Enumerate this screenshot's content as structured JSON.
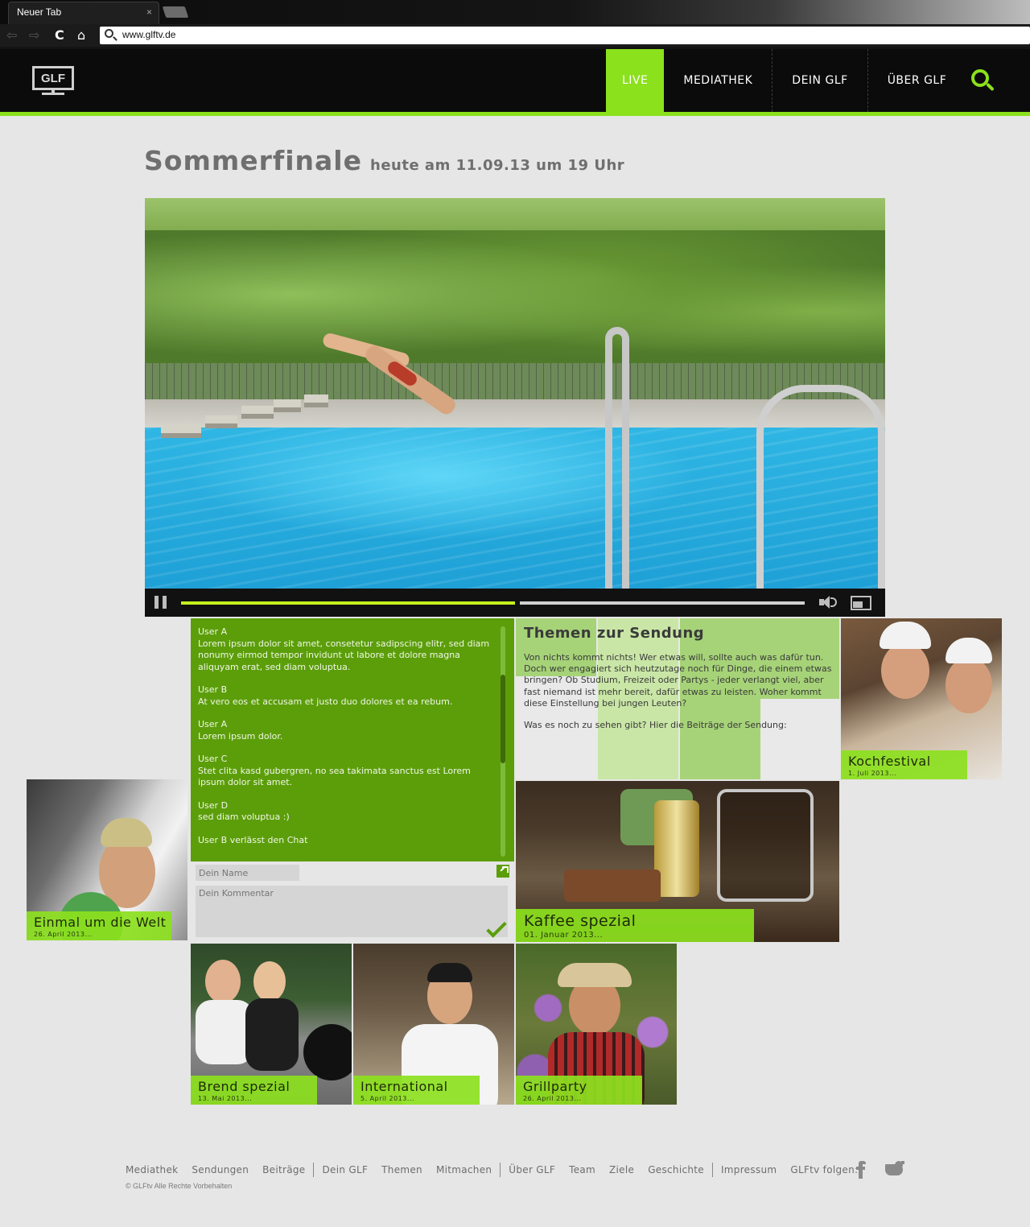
{
  "browser": {
    "tab_title": "Neuer Tab",
    "tab_close": "×",
    "url": "www.glftv.de",
    "back": "⇦",
    "forward": "⇨",
    "reload": "C",
    "home": "⌂"
  },
  "header": {
    "logo_text": "GLF",
    "nav": [
      {
        "label": "LIVE",
        "active": true
      },
      {
        "label": "MEDIATHEK",
        "active": false
      },
      {
        "label": "DEIN GLF",
        "active": false
      },
      {
        "label": "ÜBER GLF",
        "active": false
      }
    ],
    "accent_color": "#8be11c"
  },
  "headline": {
    "title": "Sommerfinale",
    "subtitle": "heute am 11.09.13 um 19 Uhr"
  },
  "player": {
    "progress": 0.54,
    "state": "playing"
  },
  "chat": {
    "messages": [
      {
        "user": "User A",
        "text": "Lorem ipsum dolor sit amet, consetetur sadipscing elitr, sed diam nonumy eirmod tempor invidunt ut labore et dolore magna aliquyam erat, sed diam voluptua."
      },
      {
        "user": "User B",
        "text": "At vero eos et accusam et justo duo dolores et ea rebum."
      },
      {
        "user": "User A",
        "text": "Lorem ipsum dolor."
      },
      {
        "user": "User C",
        "text": "Stet clita kasd gubergren, no sea takimata sanctus est Lorem ipsum dolor sit amet."
      },
      {
        "user": "User D",
        "text": "sed diam voluptua :)"
      },
      {
        "user": "User B verlässt den Chat",
        "text": ""
      }
    ],
    "name_placeholder": "Dein Name",
    "comment_placeholder": "Dein Kommentar"
  },
  "themen": {
    "title": "Themen zur Sendung",
    "text": "Von nichts kommt nichts! Wer etwas will, sollte auch was dafür tun. Doch wer engagiert sich heutzutage noch für Dinge, die einem etwas bringen? Ob Studium, Freizeit oder Partys - jeder verlangt viel, aber fast niemand ist mehr bereit, dafür etwas zu leisten. Woher kommt diese Einstellung bei jungen Leuten?",
    "cta": "Was es noch zu sehen gibt? Hier die Beiträge der Sendung:"
  },
  "tiles": {
    "kochfestival": {
      "title": "Kochfestival",
      "date": "1. Juli 2013..."
    },
    "einmal": {
      "title": "Einmal um die Welt",
      "date": "26. April 2013..."
    },
    "kaffee": {
      "title": "Kaffee spezial",
      "date": "01. Januar 2013..."
    },
    "brend": {
      "title": "Brend spezial",
      "date": "13. Mai 2013..."
    },
    "international": {
      "title": "International",
      "date": "5. April 2013..."
    },
    "grillparty": {
      "title": "Grillparty",
      "date": "26. April 2013..."
    }
  },
  "footer": {
    "links": [
      "Mediathek",
      "Sendungen",
      "Beiträge",
      "Dein GLF",
      "Themen",
      "Mitmachen",
      "Über GLF",
      "Team",
      "Ziele",
      "Geschichte",
      "Impressum"
    ],
    "follow_label": "GLFtv folgen:",
    "copyright": "© GLFtv Alle Rechte Vorbehalten",
    "social_icons": [
      "facebook-icon",
      "twitter-icon"
    ]
  }
}
